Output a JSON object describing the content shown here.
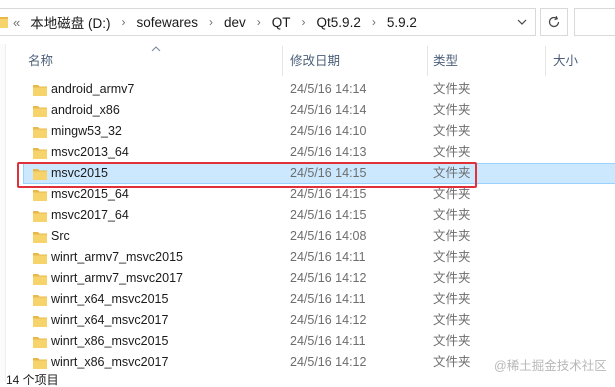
{
  "address_bar": {
    "leading": "«",
    "path": [
      "本地磁盘 (D:)",
      "sofewares",
      "dev",
      "QT",
      "Qt5.9.2",
      "5.9.2"
    ],
    "separator": "›"
  },
  "columns": {
    "name": "名称",
    "date": "修改日期",
    "type": "类型",
    "size": "大小"
  },
  "files": [
    {
      "name": "android_armv7",
      "date": "24/5/16 14:14",
      "type": "文件夹",
      "selected": false
    },
    {
      "name": "android_x86",
      "date": "24/5/16 14:14",
      "type": "文件夹",
      "selected": false
    },
    {
      "name": "mingw53_32",
      "date": "24/5/16 14:10",
      "type": "文件夹",
      "selected": false
    },
    {
      "name": "msvc2013_64",
      "date": "24/5/16 14:13",
      "type": "文件夹",
      "selected": false
    },
    {
      "name": "msvc2015",
      "date": "24/5/16 14:15",
      "type": "文件夹",
      "selected": true
    },
    {
      "name": "msvc2015_64",
      "date": "24/5/16 14:15",
      "type": "文件夹",
      "selected": false
    },
    {
      "name": "msvc2017_64",
      "date": "24/5/16 14:15",
      "type": "文件夹",
      "selected": false
    },
    {
      "name": "Src",
      "date": "24/5/16 14:08",
      "type": "文件夹",
      "selected": false
    },
    {
      "name": "winrt_armv7_msvc2015",
      "date": "24/5/16 14:11",
      "type": "文件夹",
      "selected": false
    },
    {
      "name": "winrt_armv7_msvc2017",
      "date": "24/5/16 14:12",
      "type": "文件夹",
      "selected": false
    },
    {
      "name": "winrt_x64_msvc2015",
      "date": "24/5/16 14:11",
      "type": "文件夹",
      "selected": false
    },
    {
      "name": "winrt_x64_msvc2017",
      "date": "24/5/16 14:12",
      "type": "文件夹",
      "selected": false
    },
    {
      "name": "winrt_x86_msvc2015",
      "date": "24/5/16 14:11",
      "type": "文件夹",
      "selected": false
    },
    {
      "name": "winrt_x86_msvc2017",
      "date": "24/5/16 14:12",
      "type": "文件夹",
      "selected": false
    }
  ],
  "status_bar": {
    "text": "14 个项目"
  },
  "watermark": "@稀土掘金技术社区",
  "colors": {
    "selection_bg": "#cce8ff",
    "selection_border": "#99d1ff",
    "highlight_box": "#e0313b",
    "folder_icon": "#f6d46b",
    "header_text": "#4c607a"
  },
  "icons": {
    "address_folder": "folder-icon",
    "dropdown": "chevron-down-icon",
    "refresh": "refresh-icon",
    "sort": "sort-ascending-icon",
    "row_folder": "folder-icon"
  }
}
